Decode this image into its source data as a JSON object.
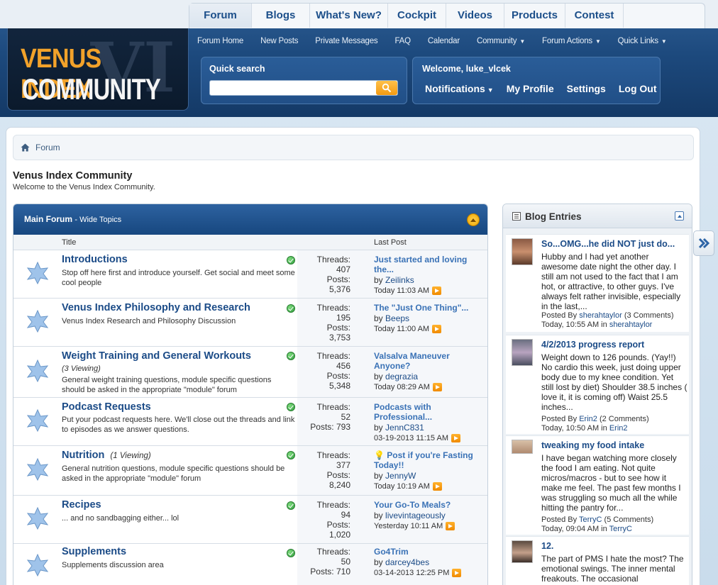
{
  "logo": {
    "line1": "VENUS INDEX",
    "line2": "COMMUNITY",
    "mark": "VI"
  },
  "main_tabs": [
    {
      "label": "Forum",
      "active": true
    },
    {
      "label": "Blogs"
    },
    {
      "label": "What's New?"
    },
    {
      "label": "Cockpit"
    },
    {
      "label": "Videos"
    },
    {
      "label": "Products"
    },
    {
      "label": "Contest"
    }
  ],
  "sub_nav": [
    "Forum Home",
    "New Posts",
    "Private Messages",
    "FAQ",
    "Calendar",
    "Community",
    "Forum Actions",
    "Quick Links"
  ],
  "search": {
    "label": "Quick search",
    "value": ""
  },
  "user": {
    "welcome": "Welcome, luke_vlcek",
    "links": [
      "Notifications",
      "My Profile",
      "Settings",
      "Log Out"
    ]
  },
  "breadcrumb": "Forum",
  "page": {
    "title": "Venus Index Community",
    "subtitle": "Welcome to the Venus Index Community."
  },
  "forum": {
    "header": "Main Forum",
    "header_small": "- Wide Topics",
    "col_title": "Title",
    "col_lastpost": "Last Post",
    "rows": [
      {
        "title": "Introductions",
        "viewing": "",
        "desc": "Stop off here first and introduce yourself. Get social and meet some cool people",
        "threads": "407",
        "posts": "5,376",
        "lp_title": "Just started and loving the...",
        "lp_user": "Zeilinks",
        "lp_time": "Today 11:03 AM"
      },
      {
        "title": "Venus Index Philosophy and Research",
        "viewing": "",
        "desc": "Venus Index Research and Philosophy Discussion",
        "threads": "195",
        "posts": "3,753",
        "lp_title": "The \"Just One Thing\"...",
        "lp_user": "Beeps",
        "lp_time": "Today 11:00 AM"
      },
      {
        "title": "Weight Training and General Workouts",
        "viewing": "(3 Viewing)",
        "desc": "General weight training questions, module specific questions should be asked in the appropriate \"module\" forum",
        "threads": "456",
        "posts": "5,348",
        "lp_title": "Valsalva Maneuver Anyone?",
        "lp_user": "degrazia",
        "lp_time": "Today 08:29 AM"
      },
      {
        "title": "Podcast Requests",
        "viewing": "",
        "desc": "Put your podcast requests here. We'll close out the threads and link to episodes as we answer questions.",
        "threads": "52",
        "posts": "793",
        "lp_title": "Podcasts with Professional...",
        "lp_user": "JennC831",
        "lp_time": "03-19-2013 11:15 AM"
      },
      {
        "title": "Nutrition",
        "viewing": "(1 Viewing)",
        "desc": "General nutrition questions, module specific questions should be asked in the appropriate \"module\" forum",
        "threads": "377",
        "posts": "8,240",
        "lp_title": "Post if you're Fasting Today!!",
        "lp_user": "JennyW",
        "lp_time": "Today 10:19 AM"
      },
      {
        "title": "Recipes",
        "viewing": "",
        "desc": "... and no sandbagging either... lol",
        "threads": "94",
        "posts": "1,020",
        "lp_title": "Your Go-To Meals?",
        "lp_user": "livevintageously",
        "lp_time": "Yesterday 10:11 AM"
      },
      {
        "title": "Supplements",
        "viewing": "",
        "desc": "Supplements discussion area",
        "threads": "50",
        "posts": "710",
        "lp_title": "Go4Trim",
        "lp_user": "darcey4bes",
        "lp_time": "03-14-2013 12:25 PM"
      }
    ],
    "threads_label": "Threads:",
    "posts_label": "Posts:",
    "by_label": "by"
  },
  "blog": {
    "header": "Blog Entries",
    "entries": [
      {
        "title": "So...OMG...he did NOT just do...",
        "body": "Hubby and I had yet another awesome date night the other day. I still am not used to the fact that I am hot, or attractive, to other guys. I've always felt rather invisible, especially in the last,...",
        "posted_by": "Posted By",
        "author": "sherahtaylor",
        "comments": "(3 Comments)",
        "time": "Today, 10:55 AM in",
        "blog": "sherahtaylor"
      },
      {
        "title": "4/2/2013 progress report",
        "body": "Weight down to 126 pounds. (Yay!!) No cardio this week, just doing upper body due to my knee condition. Yet still lost by diet) Shoulder 38.5 inches ( love it, it is coming off) Waist 25.5 inches...",
        "posted_by": "Posted By",
        "author": "Erin2",
        "comments": "(2 Comments)",
        "time": "Today, 10:50 AM in",
        "blog": "Erin2"
      },
      {
        "title": "tweaking my food intake",
        "body": "I have began watching more closely the food I am eating. Not quite micros/macros - but to see how it make me feel. The past few months I was struggling so much all the while hitting the pantry for...",
        "posted_by": "Posted By",
        "author": "TerryC",
        "comments": "(5 Comments)",
        "time": "Today, 09:04 AM in",
        "blog": "TerryC"
      },
      {
        "title": "12.",
        "body": "The part of PMS I hate the most? The emotional swings. The inner mental freakouts. The occasional",
        "posted_by": "",
        "author": "",
        "comments": "",
        "time": "",
        "blog": ""
      }
    ]
  }
}
